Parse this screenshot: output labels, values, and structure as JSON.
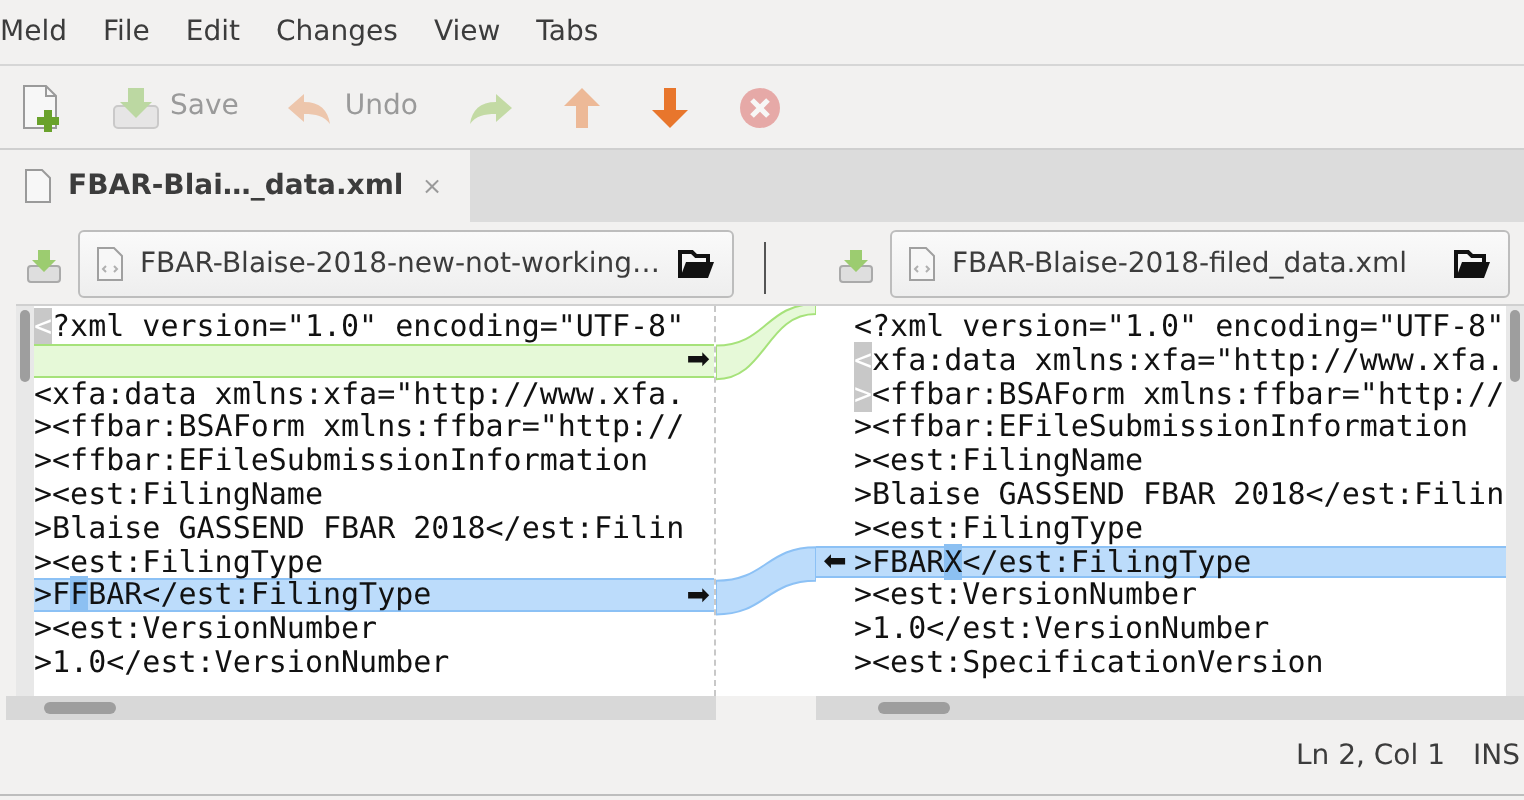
{
  "menu": [
    "Meld",
    "File",
    "Edit",
    "Changes",
    "View",
    "Tabs"
  ],
  "toolbar": [
    {
      "kind": "new",
      "disabled": false
    },
    {
      "kind": "save",
      "label": "Save",
      "disabled": true
    },
    {
      "kind": "undo",
      "label": "Undo",
      "disabled": true
    },
    {
      "kind": "redo",
      "disabled": true
    },
    {
      "kind": "up",
      "disabled": true
    },
    {
      "kind": "down",
      "disabled": false
    },
    {
      "kind": "stop",
      "disabled": true
    }
  ],
  "tabs": [
    {
      "label": "FBAR-Blai…_data.xml",
      "selected": true,
      "close": "×"
    }
  ],
  "panes": [
    {
      "file": "FBAR-Blaise-2018-new-not-working…",
      "lines": [
        {
          "kind": "equal",
          "segments": [
            {
              "text": "<",
              "kind": "marked"
            },
            {
              "text": "?xml version=\"1.0\" encoding=\"UTF-8\"",
              "kind": "plain"
            }
          ]
        },
        {
          "kind": "filler",
          "arrow": "➡"
        },
        {
          "kind": "equal",
          "segments": [
            {
              "text": "<xfa:data xmlns:xfa=\"http://www.xfa.",
              "kind": "plain"
            }
          ]
        },
        {
          "kind": "equal",
          "segments": [
            {
              "text": "><ffbar:BSAForm xmlns:ffbar=\"http://",
              "kind": "plain"
            }
          ]
        },
        {
          "kind": "equal",
          "segments": [
            {
              "text": "><ffbar:EFileSubmissionInformation",
              "kind": "plain"
            }
          ]
        },
        {
          "kind": "equal",
          "segments": [
            {
              "text": "><est:FilingName",
              "kind": "plain"
            }
          ]
        },
        {
          "kind": "equal",
          "segments": [
            {
              "text": ">Blaise GASSEND FBAR 2018</est:Filin",
              "kind": "plain"
            }
          ]
        },
        {
          "kind": "equal",
          "segments": [
            {
              "text": "><est:FilingType",
              "kind": "plain"
            }
          ]
        },
        {
          "kind": "changed",
          "arrow": "➡",
          "segments": [
            {
              "text": ">F",
              "kind": "plain"
            },
            {
              "text": "F",
              "kind": "inline"
            },
            {
              "text": "BAR</est:FilingType",
              "kind": "plain"
            }
          ]
        },
        {
          "kind": "equal",
          "segments": [
            {
              "text": "><est:VersionNumber",
              "kind": "plain"
            }
          ]
        },
        {
          "kind": "equal",
          "segments": [
            {
              "text": ">1.0</est:VersionNumber",
              "kind": "plain"
            }
          ]
        }
      ]
    },
    {
      "file": "FBAR-Blaise-2018-filed_data.xml",
      "lines": [
        {
          "kind": "equal",
          "segments": [
            {
              "text": "<?xml version=\"1.0\" encoding=\"UTF-8\"",
              "kind": "plain"
            }
          ]
        },
        {
          "kind": "equal",
          "segments": [
            {
              "text": "<",
              "kind": "marked"
            },
            {
              "text": "xfa:data xmlns:xfa=\"http://www.xfa.",
              "kind": "plain"
            }
          ]
        },
        {
          "kind": "equal",
          "segments": [
            {
              "text": ">",
              "kind": "marked"
            },
            {
              "text": "<ffbar:BSAForm xmlns:ffbar=\"http://",
              "kind": "plain"
            }
          ]
        },
        {
          "kind": "equal",
          "segments": [
            {
              "text": "><ffbar:EFileSubmissionInformation",
              "kind": "plain"
            }
          ]
        },
        {
          "kind": "equal",
          "segments": [
            {
              "text": "><est:FilingName",
              "kind": "plain"
            }
          ]
        },
        {
          "kind": "equal",
          "segments": [
            {
              "text": ">Blaise GASSEND FBAR 2018</est:Filin",
              "kind": "plain"
            }
          ]
        },
        {
          "kind": "equal",
          "segments": [
            {
              "text": "><est:FilingType",
              "kind": "plain"
            }
          ]
        },
        {
          "kind": "changed",
          "arrow": "⬅",
          "segments": [
            {
              "text": ">FBAR",
              "kind": "plain"
            },
            {
              "text": "X",
              "kind": "inline"
            },
            {
              "text": "</est:FilingType",
              "kind": "plain"
            }
          ]
        },
        {
          "kind": "equal",
          "segments": [
            {
              "text": "><est:VersionNumber",
              "kind": "plain"
            }
          ]
        },
        {
          "kind": "equal",
          "segments": [
            {
              "text": ">1.0</est:VersionNumber",
              "kind": "plain"
            }
          ]
        },
        {
          "kind": "equal",
          "segments": [
            {
              "text": "><est:SpecificationVersion",
              "kind": "plain"
            }
          ]
        }
      ]
    }
  ],
  "status_bar": {
    "position": "Ln 2, Col 1",
    "mode": "INS"
  }
}
